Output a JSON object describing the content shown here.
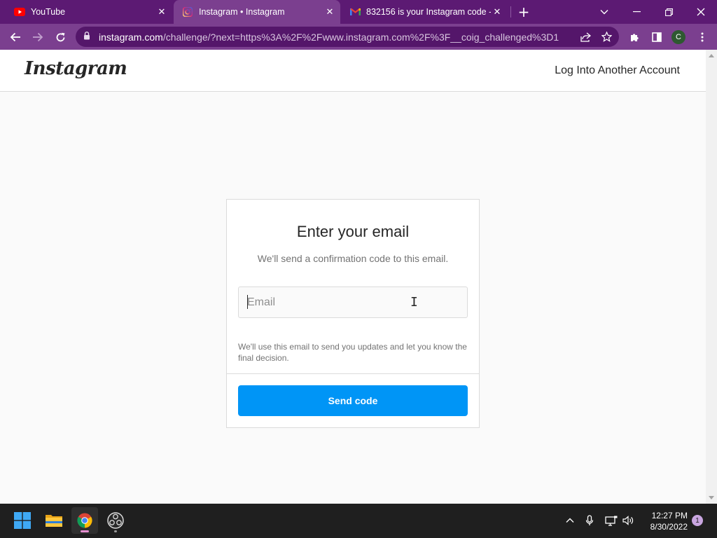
{
  "browser": {
    "tabs": [
      {
        "title": "YouTube",
        "icon": "youtube-icon",
        "active": false
      },
      {
        "title": "Instagram • Instagram",
        "icon": "instagram-icon",
        "active": true
      },
      {
        "title": "832156 is your Instagram code -",
        "icon": "gmail-icon",
        "active": false
      }
    ],
    "url_host": "instagram.com",
    "url_rest": "/challenge/?next=https%3A%2F%2Fwww.instagram.com%2F%3F__coig_challenged%3D1",
    "profile_initial": "C",
    "accent_color": "#7b3f8f",
    "tabstrip_color": "#5c1a73"
  },
  "header": {
    "logo_text": "Instagram",
    "switch_account_label": "Log Into Another Account"
  },
  "form": {
    "title": "Enter your email",
    "subtitle": "We'll send a confirmation code to this email.",
    "email_placeholder": "Email",
    "email_value": "",
    "note": "We'll use this email to send you updates and let you know the final decision.",
    "submit_label": "Send code",
    "button_color": "#0095f6"
  },
  "taskbar": {
    "time": "12:27 PM",
    "date": "8/30/2022",
    "notification_count": "1"
  }
}
